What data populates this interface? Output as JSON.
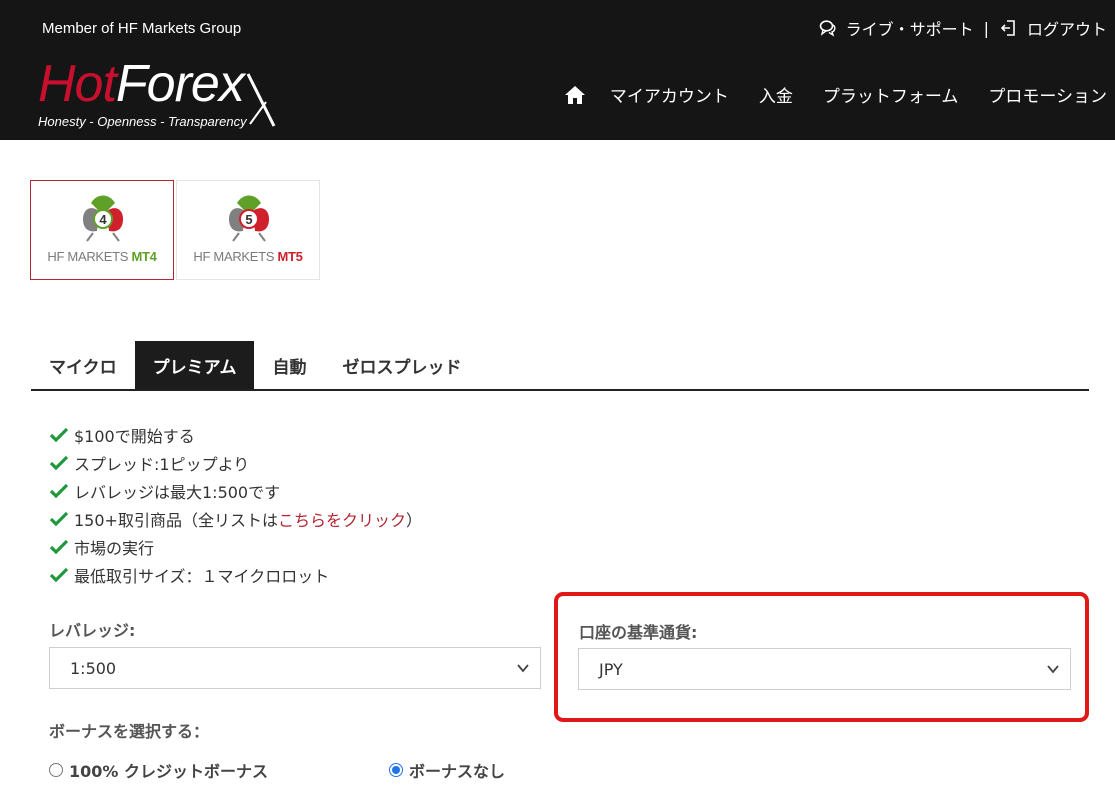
{
  "header": {
    "member_text": "Member of HF Markets Group",
    "logo_word_hot": "Hot",
    "logo_word_forex": "Forex",
    "logo_tagline": "Honesty - Openness - Transparency",
    "live_support": "ライブ・サポート",
    "separator": "|",
    "logout": "ログアウト",
    "nav": [
      "マイアカウント",
      "入金",
      "プラットフォーム",
      "プロモーション"
    ]
  },
  "platforms": [
    {
      "number": "4",
      "label_main": "HF MARKETS ",
      "label_accent": "MT4"
    },
    {
      "number": "5",
      "label_main": "HF MARKETS ",
      "label_accent": "MT5"
    }
  ],
  "tabs": [
    "マイクロ",
    "プレミアム",
    "自動",
    "ゼロスプレッド"
  ],
  "active_tab": "プレミアム",
  "features": {
    "f1": "$100で開始する",
    "f2": "スプレッド:1ピップより",
    "f3": "レバレッジは最大1:500です",
    "f4_before": "150+取引商品（全リストは",
    "f4_link": "こちらをクリック",
    "f4_after": "）",
    "f5": "市場の実行",
    "f6": "最低取引サイズ：１マイクロロット"
  },
  "form": {
    "leverage_label": "レバレッジ:",
    "leverage_value": "1:500",
    "currency_label": "口座の基準通貨:",
    "currency_value": "JPY",
    "bonus_label": "ボーナスを選択する：",
    "bonus_option_1": "100% クレジットボーナス",
    "bonus_option_2": "ボーナスなし",
    "bonus_selected": "ボーナスなし"
  },
  "colors": {
    "brand_red": "#c8102e",
    "header_bg": "#151515",
    "check_green": "#1e9a3c",
    "highlight_red": "#e01818",
    "radio_blue": "#1e73e8"
  }
}
